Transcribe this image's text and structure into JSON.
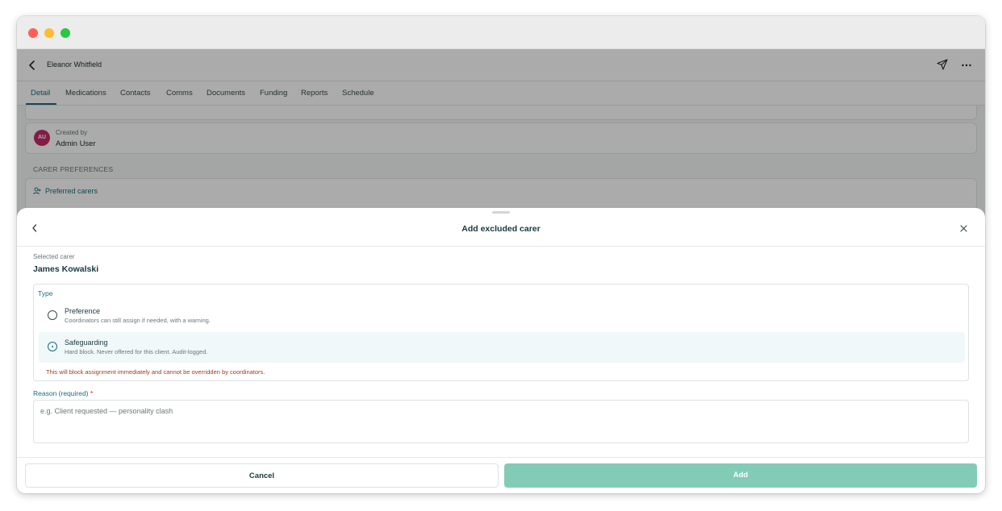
{
  "header": {
    "client_name": "Eleanor Whitfield",
    "back_icon": "chevron-left-icon",
    "send_icon": "send-icon",
    "more_icon": "more-icon"
  },
  "tabs": [
    {
      "label": "Detail",
      "active": true
    },
    {
      "label": "Medications",
      "active": false
    },
    {
      "label": "Contacts",
      "active": false
    },
    {
      "label": "Comms",
      "active": false
    },
    {
      "label": "Documents",
      "active": false
    },
    {
      "label": "Funding",
      "active": false
    },
    {
      "label": "Reports",
      "active": false
    },
    {
      "label": "Schedule",
      "active": false
    }
  ],
  "created": {
    "avatar_initials": "AU",
    "label": "Created by",
    "value": "Admin User"
  },
  "carer_preferences": {
    "section_label": "CARER PREFERENCES",
    "preferred_link": "Preferred carers"
  },
  "sheet": {
    "title": "Add excluded carer",
    "selected_label": "Selected carer",
    "selected_value": "James Kowalski",
    "type_label": "Type",
    "options": [
      {
        "title": "Preference",
        "description": "Coordinators can still assign if needed, with a warning.",
        "selected": false
      },
      {
        "title": "Safeguarding",
        "description": "Hard block. Never offered for this client. Audit-logged.",
        "selected": true
      }
    ],
    "warning": "This will block assignment immediately and cannot be overridden by coordinators.",
    "reason_label": "Reason (required)",
    "reason_required_mark": "*",
    "reason_placeholder": "e.g. Client requested — personality clash",
    "reason_value": "",
    "cancel_label": "Cancel",
    "add_label": "Add"
  },
  "colors": {
    "accent": "#166e80",
    "add_button": "#82ccb6",
    "avatar": "#c42a6b",
    "warning": "#a13d1d"
  }
}
